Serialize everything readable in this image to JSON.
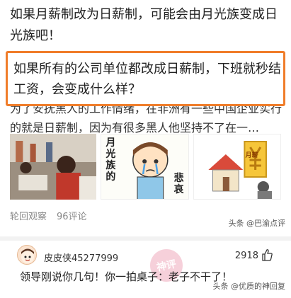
{
  "headline": "如果月薪制改为日薪制，可能会由月光族变成日光族吧！",
  "article": {
    "title": "如果所有的公司单位都改成日薪制，下班就秒结工资，会变成什么样？",
    "snippet": "为了安抚黑人的工作情绪，在非洲有一些中国企业实行的就是日薪制，因为有很多黑人他坚持不了在一…",
    "thumb2_text": [
      "月",
      "光",
      "族",
      "的",
      "悲",
      "哀"
    ],
    "thumb3_text": "月薪",
    "meta": {
      "source": "轮回观察",
      "comments": "96评论"
    },
    "source_tag": "头条 @巴渝点评"
  },
  "comment": {
    "user": "皮皮侠45277999",
    "likes": "2918",
    "text": "领导刚说你几句！你一拍桌子：老子不干了！",
    "stamp": "神评",
    "footer_source": "头条 @优质的神回复"
  },
  "colors": {
    "highlight_border": "#f07d2a",
    "text": "#222222",
    "meta": "#888888"
  }
}
